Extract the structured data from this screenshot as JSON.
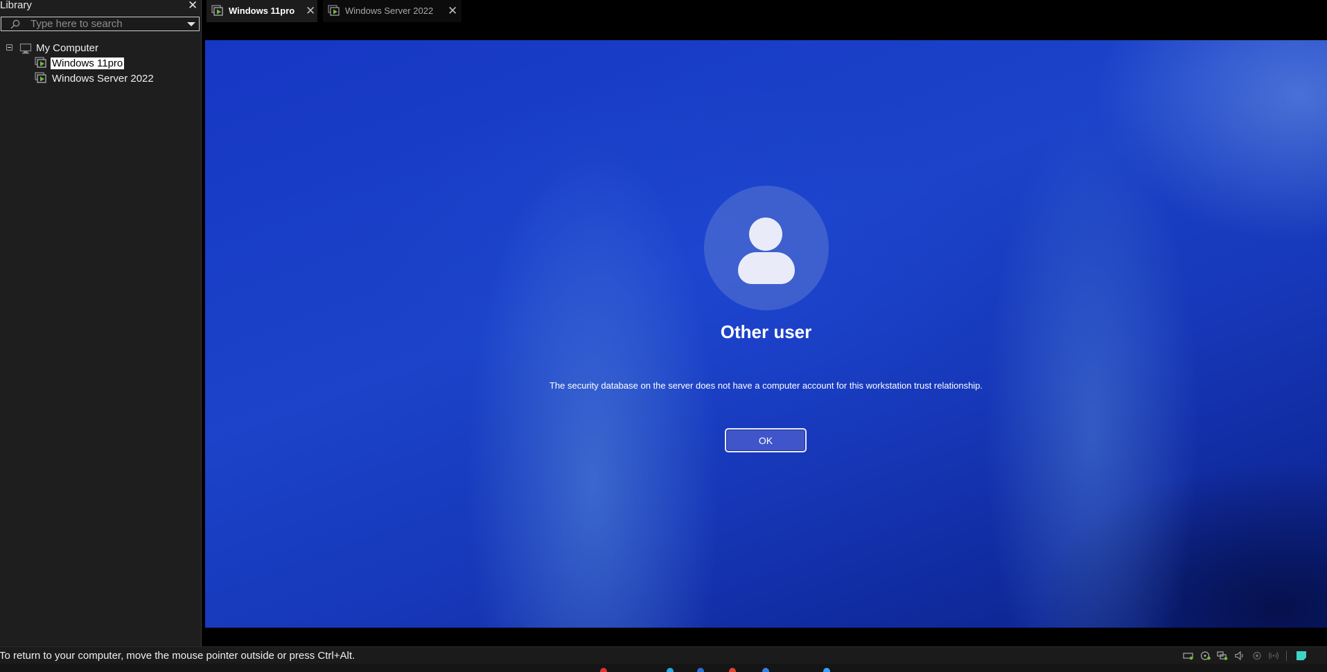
{
  "library": {
    "title": "Library",
    "search_placeholder": "Type here to search",
    "tree": {
      "root_label": "My Computer",
      "items": [
        {
          "label": "Windows 11pro",
          "selected": true
        },
        {
          "label": "Windows Server 2022",
          "selected": false
        }
      ]
    }
  },
  "tabs": [
    {
      "label": "Windows 11pro",
      "active": true
    },
    {
      "label": "Windows Server 2022",
      "active": false
    }
  ],
  "vm": {
    "user_name": "Other user",
    "message": "The security database on the server does not have a computer account for this workstation trust relationship.",
    "ok_label": "OK"
  },
  "statusbar": {
    "text": "To return to your computer, move the mouse pointer outside or press Ctrl+Alt.",
    "device_icons": [
      "hard-disk-icon",
      "cd-dvd-icon",
      "network-adapter-icon",
      "sound-card-icon",
      "usb-controller-icon",
      "wireless-icon",
      "notes-icon"
    ]
  },
  "colors": {
    "accent_green": "#6abf3a",
    "vm_background": "#1a3ec6",
    "ok_button": "#3f55c9"
  }
}
